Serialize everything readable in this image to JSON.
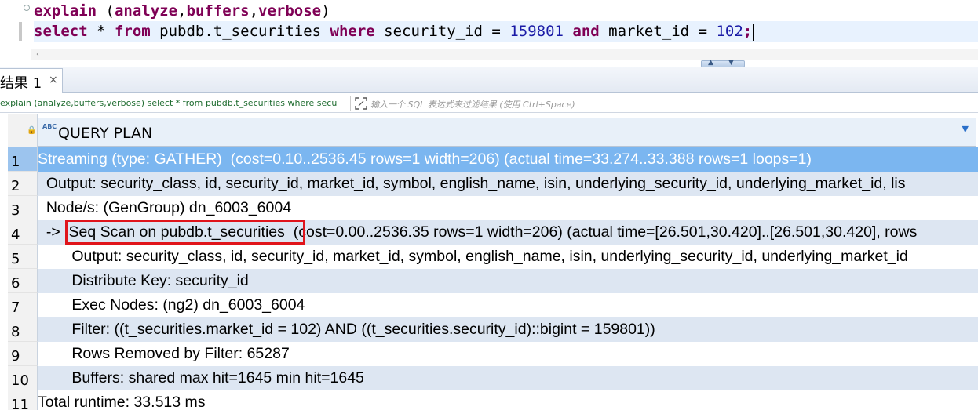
{
  "editor": {
    "line1": {
      "kw1": "explain",
      "rest": " (",
      "kw2": "analyze",
      "c1": ",",
      "kw3": "buffers",
      "c2": ",",
      "kw4": "verbose",
      "end": ")"
    },
    "line2": {
      "kw1": "select",
      "t1": " * ",
      "kw2": "from",
      "t2": " pubdb.t_securities ",
      "kw3": "where",
      "t3": " security_id = ",
      "n1": "159801",
      "t4": " ",
      "kw4": "and",
      "t5": " market_id = ",
      "n2": "102",
      "t6": ";"
    }
  },
  "tab": {
    "label": "结果 1",
    "close": "×"
  },
  "filter": {
    "query": "explain (analyze,buffers,verbose) select * from pubdb.t_securities where secu",
    "placeholder": "输入一个 SQL 表达式来过滤结果 (使用 Ctrl+Space)"
  },
  "grid": {
    "column": "QUERY PLAN",
    "rows": [
      {
        "n": "1",
        "text": "Streaming (type: GATHER)  (cost=0.10..2536.45 rows=1 width=206) (actual time=33.274..33.388 rows=1 loops=1)"
      },
      {
        "n": "2",
        "text": "  Output: security_class, id, security_id, market_id, symbol, english_name, isin, underlying_security_id, underlying_market_id, lis"
      },
      {
        "n": "3",
        "text": "  Node/s: (GenGroup) dn_6003_6004"
      },
      {
        "n": "4",
        "text": "  ->  Seq Scan on pubdb.t_securities  (cost=0.00..2536.35 rows=1 width=206) (actual time=[26.501,30.420]..[26.501,30.420], rows"
      },
      {
        "n": "5",
        "text": "        Output: security_class, id, security_id, market_id, symbol, english_name, isin, underlying_security_id, underlying_market_id"
      },
      {
        "n": "6",
        "text": "        Distribute Key: security_id"
      },
      {
        "n": "7",
        "text": "        Exec Nodes: (ng2) dn_6003_6004"
      },
      {
        "n": "8",
        "text": "        Filter: ((t_securities.market_id = 102) AND ((t_securities.security_id)::bigint = 159801))"
      },
      {
        "n": "9",
        "text": "        Rows Removed by Filter: 65287"
      },
      {
        "n": "10",
        "text": "        Buffers: shared max hit=1645 min hit=1645"
      },
      {
        "n": "11",
        "text": "Total runtime: 33.513 ms"
      }
    ]
  },
  "colors": {
    "selected_row": "#7bb6f0",
    "alt_row": "#dde6f2",
    "highlight_box": "#e0141b",
    "keyword": "#7f0055"
  }
}
